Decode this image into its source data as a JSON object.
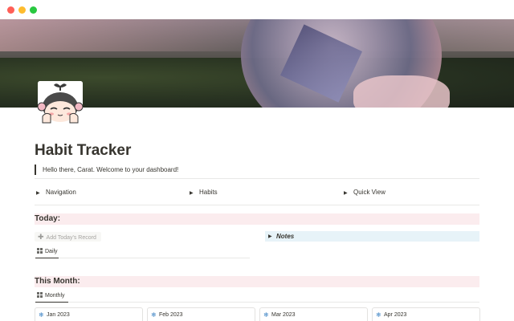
{
  "window": {
    "controls": [
      "close",
      "minimize",
      "zoom"
    ]
  },
  "page": {
    "title": "Habit Tracker",
    "avatar_icon": "chibi-character-icon",
    "callout_text": "Hello there, Carat. Welcome to your dashboard!"
  },
  "toggles": [
    {
      "label": "Navigation"
    },
    {
      "label": "Habits"
    },
    {
      "label": "Quick View"
    }
  ],
  "today": {
    "heading": "Today:",
    "add_button_label": "Add Today's Record",
    "view_tab_label": "Daily",
    "notes_label": "Notes"
  },
  "this_month": {
    "heading": "This Month:",
    "view_tab_label": "Monthly",
    "cards": [
      {
        "label": "Jan 2023",
        "icon": "snowflake-icon"
      },
      {
        "label": "Feb 2023",
        "icon": "snowflake-icon"
      },
      {
        "label": "Mar 2023",
        "icon": "snowflake-icon"
      },
      {
        "label": "Apr 2023",
        "icon": "snowflake-icon"
      }
    ]
  },
  "colors": {
    "section_header_bg": "#fbecee",
    "notes_bg": "#e7f3f8",
    "text": "#37352f"
  }
}
